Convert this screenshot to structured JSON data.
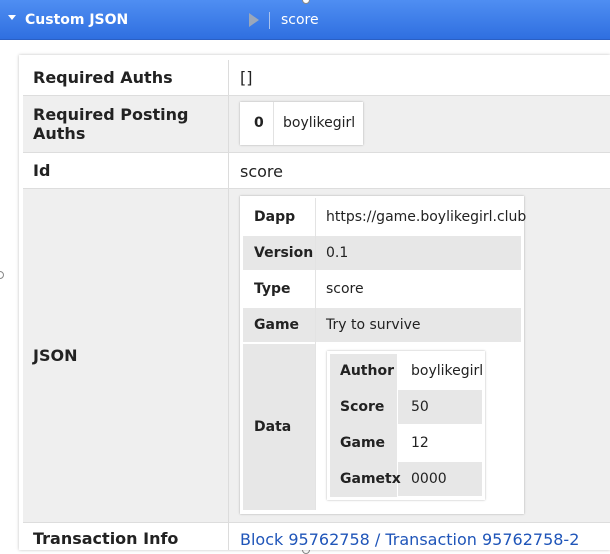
{
  "header": {
    "title": "Custom JSON",
    "value": "score"
  },
  "rows": {
    "required_auths": {
      "label": "Required Auths",
      "value": "[]"
    },
    "required_posting_auths": {
      "label": "Required Posting Auths",
      "index": "0",
      "account": "boylikegirl"
    },
    "id": {
      "label": "Id",
      "value": "score"
    },
    "json": {
      "label": "JSON",
      "dapp": {
        "key": "Dapp",
        "value": "https://game.boylikegirl.club"
      },
      "version": {
        "key": "Version",
        "value": "0.1"
      },
      "type": {
        "key": "Type",
        "value": "score"
      },
      "game": {
        "key": "Game",
        "value": "Try to survive"
      },
      "data": {
        "key": "Data",
        "author": {
          "key": "Author",
          "value": "boylikegirl"
        },
        "score": {
          "key": "Score",
          "value": "50"
        },
        "game": {
          "key": "Game",
          "value": "12"
        },
        "gametx": {
          "key": "Gametx",
          "value": "0000"
        }
      }
    },
    "transaction_info": {
      "label": "Transaction Info",
      "block": "Block 95762758",
      "separator": "/",
      "transaction": "Transaction 95762758-2"
    }
  },
  "colors": {
    "header_blue": "#2f6fe0",
    "link_blue": "#1f55b9",
    "row_alt": "#efefef"
  }
}
